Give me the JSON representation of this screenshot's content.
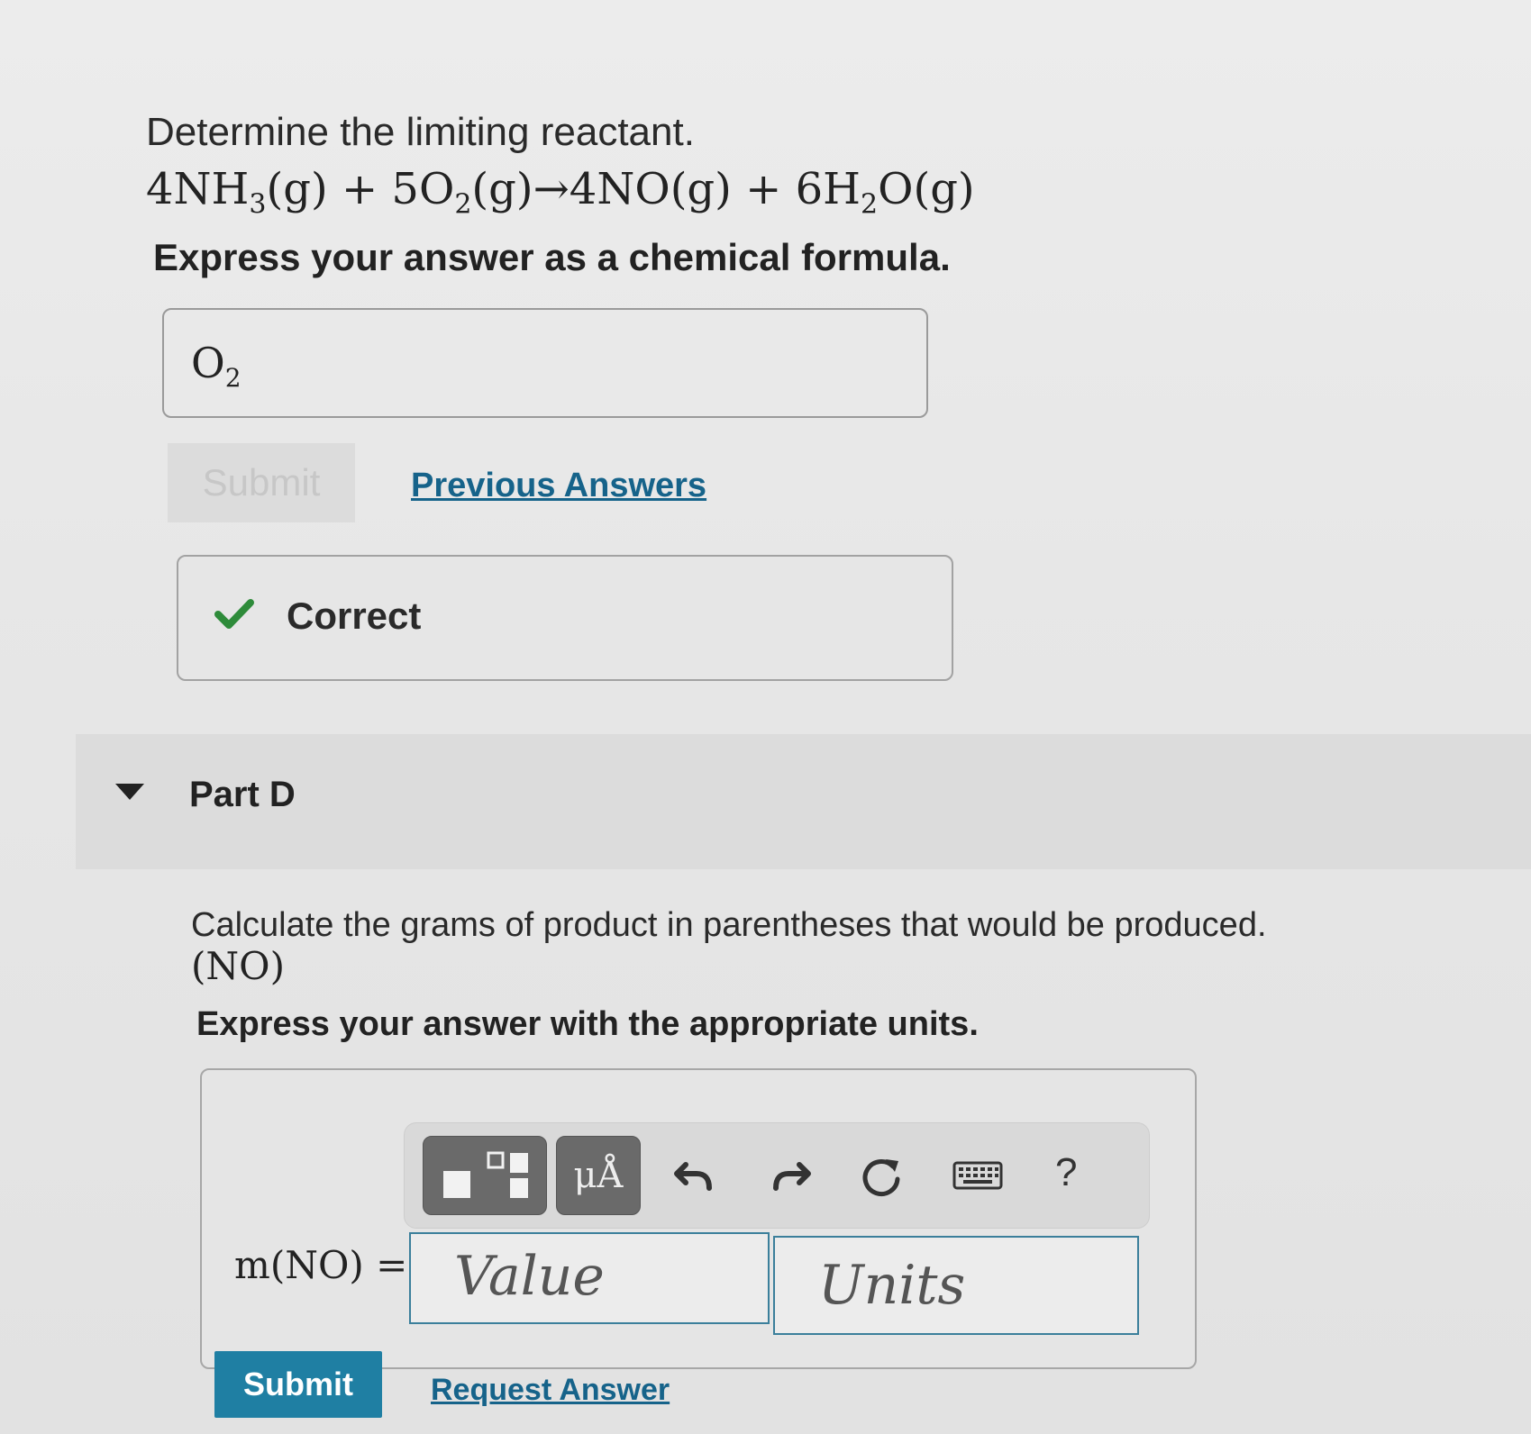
{
  "part_c": {
    "prompt": "Determine the limiting reactant.",
    "equation": {
      "c1": "4NH",
      "s1": "3",
      "p1": "(g) + 5O",
      "s2": "2",
      "p2": "(g)→4NO(g) + 6H",
      "s3": "2",
      "p3": "O(g)"
    },
    "instruction": "Express your answer as a chemical formula.",
    "answer": {
      "base": "O",
      "sub": "2"
    },
    "submit_label": "Submit",
    "previous_answers_label": "Previous Answers",
    "feedback": "Correct"
  },
  "part_d": {
    "title": "Part D",
    "question": "Calculate the grams of product in parentheses that would be produced.",
    "question_sub": "(NO)",
    "instruction": "Express your answer with the appropriate units.",
    "toolbar": {
      "units_symbol": "μÅ",
      "help": "?"
    },
    "equation_label": "m(NO) =",
    "value_placeholder": "Value",
    "units_placeholder": "Units",
    "submit_label": "Submit",
    "request_answer_label": "Request Answer"
  },
  "colors": {
    "accent": "#1f7fa3",
    "link": "#16638a",
    "check": "#2e8b3a"
  },
  "icons": [
    "fraction-template-icon",
    "units-icon",
    "undo-icon",
    "redo-icon",
    "reset-icon",
    "keyboard-icon",
    "help-icon",
    "checkmark-icon",
    "collapse-triangle-icon"
  ]
}
